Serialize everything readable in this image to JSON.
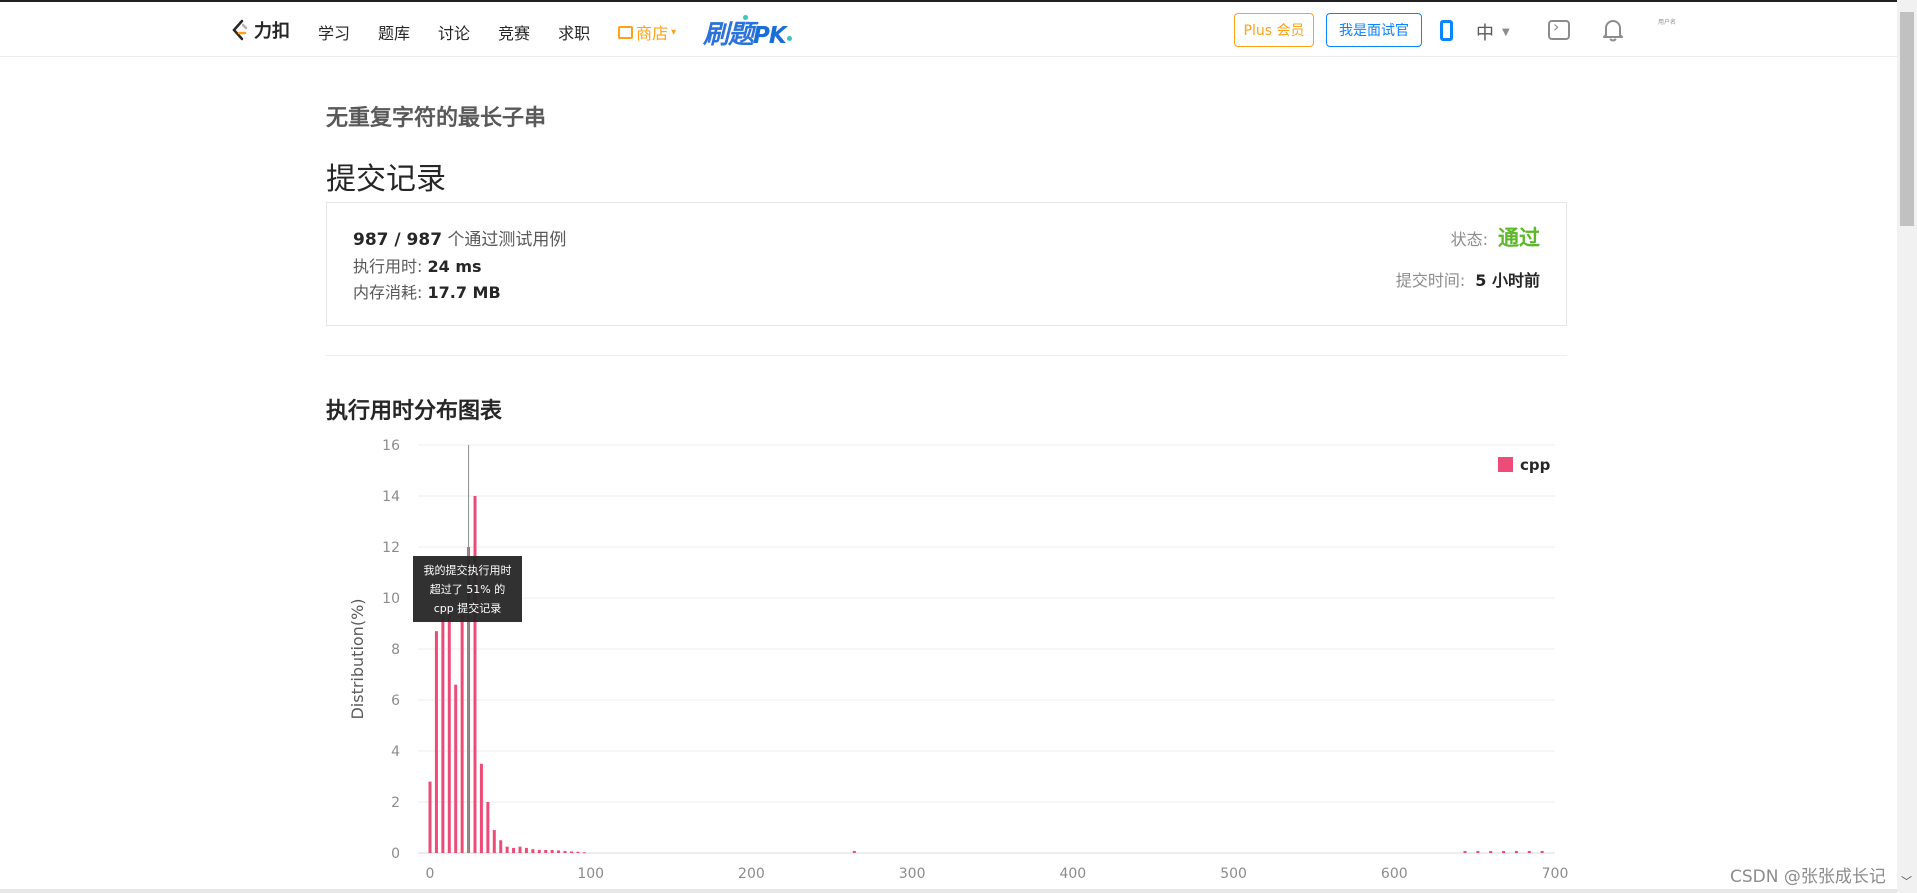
{
  "nav": {
    "logo_text": "力扣",
    "items": [
      "学习",
      "题库",
      "讨论",
      "竞赛",
      "求职"
    ],
    "store": "商店",
    "pk_text": "刷题",
    "pk_suffix": "PK",
    "plus_button": "Plus 会员",
    "interviewer_button": "我是面试官",
    "language": "中",
    "avatar_text": "用户名"
  },
  "problem": {
    "title": "无重复字符的最长子串"
  },
  "submission": {
    "heading": "提交记录",
    "passed": "987 / 987",
    "passed_label": "个通过测试用例",
    "runtime_label": "执行用时:",
    "runtime_value": "24 ms",
    "memory_label": "内存消耗:",
    "memory_value": "17.7 MB",
    "status_label": "状态:",
    "status_value": "通过",
    "time_label": "提交时间:",
    "time_value": "5 小时前"
  },
  "chart_section": {
    "title": "执行用时分布图表",
    "tooltip_lines": [
      "我的提交执行用时",
      "超过了 51% 的",
      "cpp 提交记录"
    ]
  },
  "chart_data": {
    "type": "bar",
    "ylabel": "Distribution(%)",
    "xlabel": "",
    "xlim": [
      0,
      700
    ],
    "ylim": [
      0,
      16
    ],
    "x_ticks": [
      0,
      100,
      200,
      300,
      400,
      500,
      600,
      700
    ],
    "y_ticks": [
      0,
      2,
      4,
      6,
      8,
      10,
      12,
      14,
      16
    ],
    "grid": true,
    "legend_position": "top-right",
    "marker_x": 24,
    "series": [
      {
        "name": "cpp",
        "color": "#ed4c78",
        "x": [
          0,
          4,
          8,
          12,
          16,
          20,
          24,
          28,
          32,
          36,
          40,
          44,
          48,
          52,
          56,
          60,
          64,
          68,
          72,
          76,
          80,
          84,
          88,
          92,
          96,
          264,
          644,
          652,
          660,
          668,
          676,
          684,
          692
        ],
        "values": [
          2.8,
          8.7,
          9.3,
          9.4,
          6.6,
          9.4,
          12.0,
          14.0,
          3.5,
          2.0,
          0.9,
          0.5,
          0.25,
          0.2,
          0.25,
          0.2,
          0.15,
          0.12,
          0.12,
          0.12,
          0.1,
          0.08,
          0.06,
          0.05,
          0.03,
          0.08,
          0.08,
          0.08,
          0.08,
          0.08,
          0.08,
          0.08,
          0.08
        ]
      }
    ]
  },
  "watermark": "CSDN @张张成长记"
}
